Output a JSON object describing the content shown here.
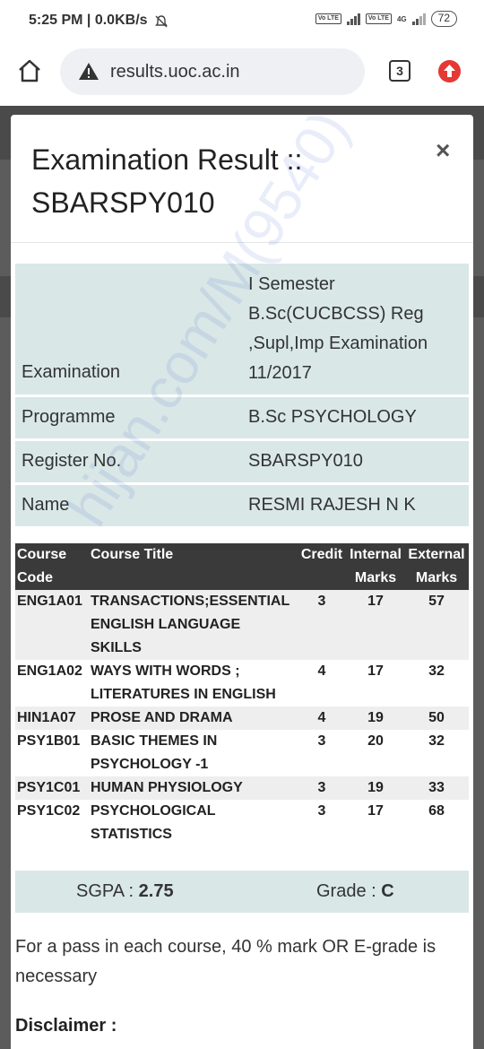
{
  "status_bar": {
    "time_speed": "5:25 PM | 0.0KB/s",
    "volte_label": "Vo LTE",
    "network_label": "4G",
    "battery": "72"
  },
  "browser": {
    "url": "results.uoc.ac.in",
    "tab_count": "3"
  },
  "modal": {
    "title": "Examination Result :: SBARSPY010",
    "close_label": "×",
    "info": {
      "examination_label": "Examination",
      "examination_value": "I Semester B.Sc(CUCBCSS) Reg ,Supl,Imp Examination 11/2017",
      "programme_label": "Programme",
      "programme_value": "B.Sc PSYCHOLOGY",
      "register_label": "Register No.",
      "register_value": "SBARSPY010",
      "name_label": "Name",
      "name_value": "RESMI RAJESH N K"
    },
    "table": {
      "headers": {
        "code": "Course Code",
        "title": "Course Title",
        "credit": "Credit",
        "internal": "Internal Marks",
        "external": "External Marks"
      },
      "rows": [
        {
          "code": "ENG1A01",
          "title": "TRANSACTIONS;ESSENTIAL ENGLISH LANGUAGE SKILLS",
          "credit": "3",
          "internal": "17",
          "external": "57"
        },
        {
          "code": "ENG1A02",
          "title": "WAYS WITH WORDS ; LITERATURES IN ENGLISH",
          "credit": "4",
          "internal": "17",
          "external": "32"
        },
        {
          "code": "HIN1A07",
          "title": "PROSE AND DRAMA",
          "credit": "4",
          "internal": "19",
          "external": "50"
        },
        {
          "code": "PSY1B01",
          "title": "BASIC THEMES IN PSYCHOLOGY -1",
          "credit": "3",
          "internal": "20",
          "external": "32"
        },
        {
          "code": "PSY1C01",
          "title": "HUMAN PHYSIOLOGY",
          "credit": "3",
          "internal": "19",
          "external": "33"
        },
        {
          "code": "PSY1C02",
          "title": "PSYCHOLOGICAL STATISTICS",
          "credit": "3",
          "internal": "17",
          "external": "68"
        }
      ]
    },
    "sgpa_label": "SGPA : ",
    "sgpa_value": "2.75",
    "grade_label": "Grade : ",
    "grade_value": "C",
    "pass_note": "For a pass in each course, 40 % mark OR E-grade is necessary",
    "disclaimer_label": "Disclaimer :"
  },
  "watermark_text": "hijan.com/M(9540)",
  "icons": {
    "home": "home-icon",
    "security_warning": "warning-icon",
    "update": "update-arrow-icon",
    "silent": "bell-off-icon",
    "close": "close-icon"
  },
  "colors": {
    "info_row_bg": "#d9e7e7",
    "table_header_bg": "#3a3a3a",
    "update_badge": "#e53935"
  }
}
